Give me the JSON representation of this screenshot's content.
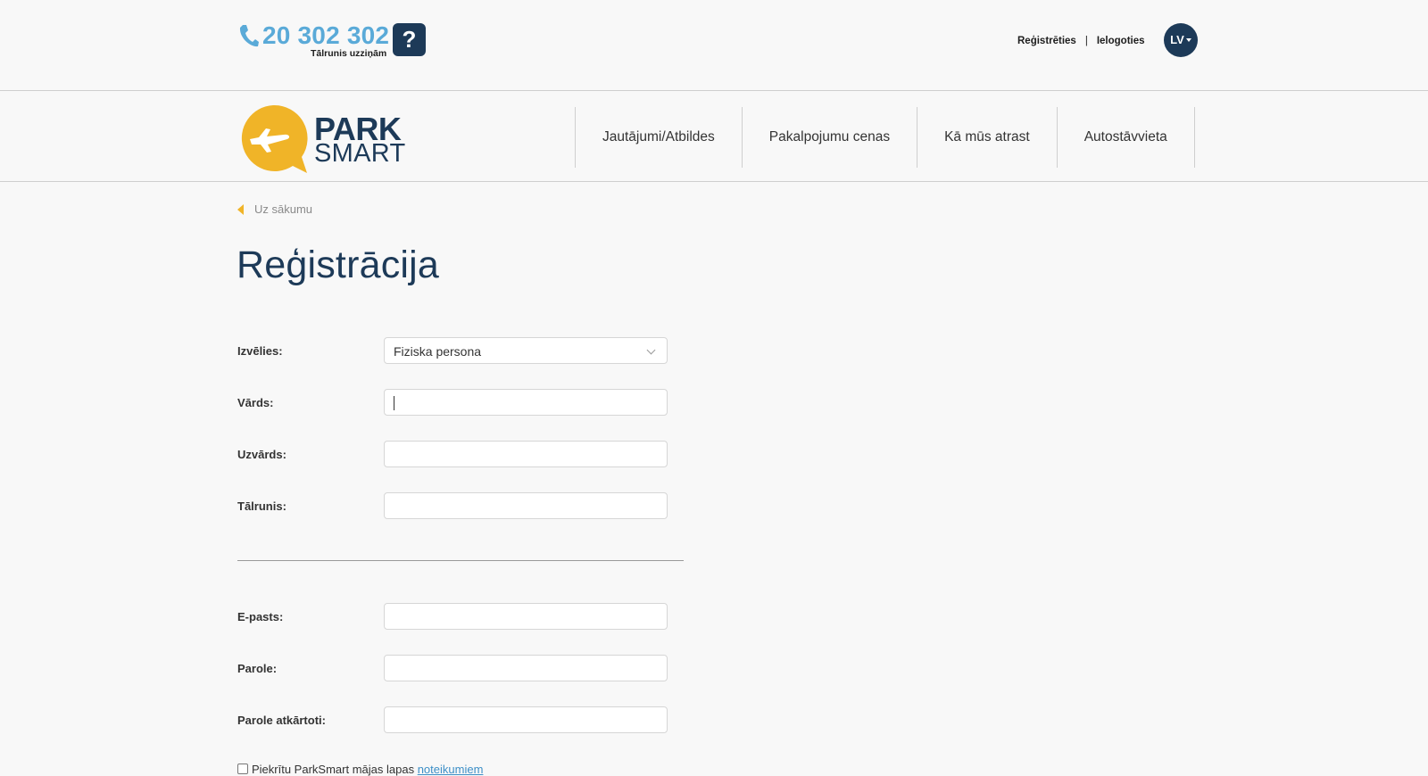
{
  "topbar": {
    "phone_number": "20 302 302",
    "phone_subtitle": "Tālrunis uzziņām",
    "help_label": "?",
    "register_link": "Reģistrēties",
    "separator": "|",
    "login_link": "Ielogoties",
    "language": "LV"
  },
  "header": {
    "logo_line1": "PARK",
    "logo_line2": "SMART",
    "nav": [
      {
        "label": "Jautājumi/Atbildes"
      },
      {
        "label": "Pakalpojumu cenas"
      },
      {
        "label": "Kā mūs atrast"
      },
      {
        "label": "Autostāvvieta"
      }
    ]
  },
  "back_link": "Uz sākumu",
  "page_title": "Reģistrācija",
  "form": {
    "type_label": "Izvēlies:",
    "type_value": "Fiziska persona",
    "first_name_label": "Vārds:",
    "last_name_label": "Uzvārds:",
    "phone_label": "Tālrunis:",
    "email_label": "E-pasts:",
    "password_label": "Parole:",
    "password_repeat_label": "Parole atkārtoti:",
    "agree_text": "Piekrītu ParkSmart mājas lapas",
    "agree_link": "noteikumiem"
  },
  "colors": {
    "brand_navy": "#1d3a58",
    "phone_blue": "#5aaad8",
    "logo_yellow": "#f0b428",
    "link_blue": "#3d8fc7"
  },
  "icons": {
    "phone": "phone-icon",
    "help": "question-icon",
    "back": "triangle-left-icon",
    "select": "chevron-down-icon",
    "logo": "airplane-icon"
  }
}
